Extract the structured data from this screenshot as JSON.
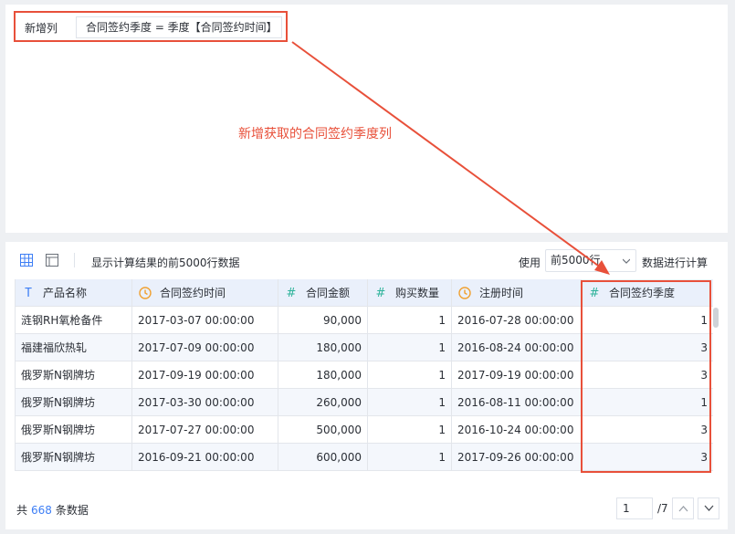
{
  "formula": {
    "label": "新增列",
    "expression": "合同签约季度 = 季度【合同签约时间】"
  },
  "annotation": "新增获取的合同签约季度列",
  "toolbar": {
    "info": "显示计算结果的前5000行数据",
    "use_label": "使用",
    "select_value": "前5000行",
    "calc_label": "数据进行计算"
  },
  "table": {
    "headers": [
      {
        "label": "产品名称",
        "icon": "text-type-icon"
      },
      {
        "label": "合同签约时间",
        "icon": "clock-icon"
      },
      {
        "label": "合同金额",
        "icon": "hash-icon"
      },
      {
        "label": "购买数量",
        "icon": "hash-icon"
      },
      {
        "label": "注册时间",
        "icon": "clock-icon"
      },
      {
        "label": "合同签约季度",
        "icon": "hash-icon"
      }
    ],
    "rows": [
      [
        "涟钢RH氧枪备件",
        "2017-03-07 00:00:00",
        "90,000",
        "1",
        "2016-07-28 00:00:00",
        "1"
      ],
      [
        "福建福欣热轧",
        "2017-07-09 00:00:00",
        "180,000",
        "1",
        "2016-08-24 00:00:00",
        "3"
      ],
      [
        "俄罗斯N钢牌坊",
        "2017-09-19 00:00:00",
        "180,000",
        "1",
        "2017-09-19 00:00:00",
        "3"
      ],
      [
        "俄罗斯N钢牌坊",
        "2017-03-30 00:00:00",
        "260,000",
        "1",
        "2016-08-11 00:00:00",
        "1"
      ],
      [
        "俄罗斯N钢牌坊",
        "2017-07-27 00:00:00",
        "500,000",
        "1",
        "2016-10-24 00:00:00",
        "3"
      ],
      [
        "俄罗斯N钢牌坊",
        "2016-09-21 00:00:00",
        "600,000",
        "1",
        "2017-09-26 00:00:00",
        "3"
      ]
    ]
  },
  "footer": {
    "prefix": "共",
    "count": "668",
    "suffix": "条数据",
    "page": "1",
    "total_pages": "/7"
  },
  "colors": {
    "annotation_red": "#e8503a",
    "accent_blue": "#3d7ef5",
    "number_green": "#2fb39b",
    "header_bg": "#eaf0fb"
  }
}
